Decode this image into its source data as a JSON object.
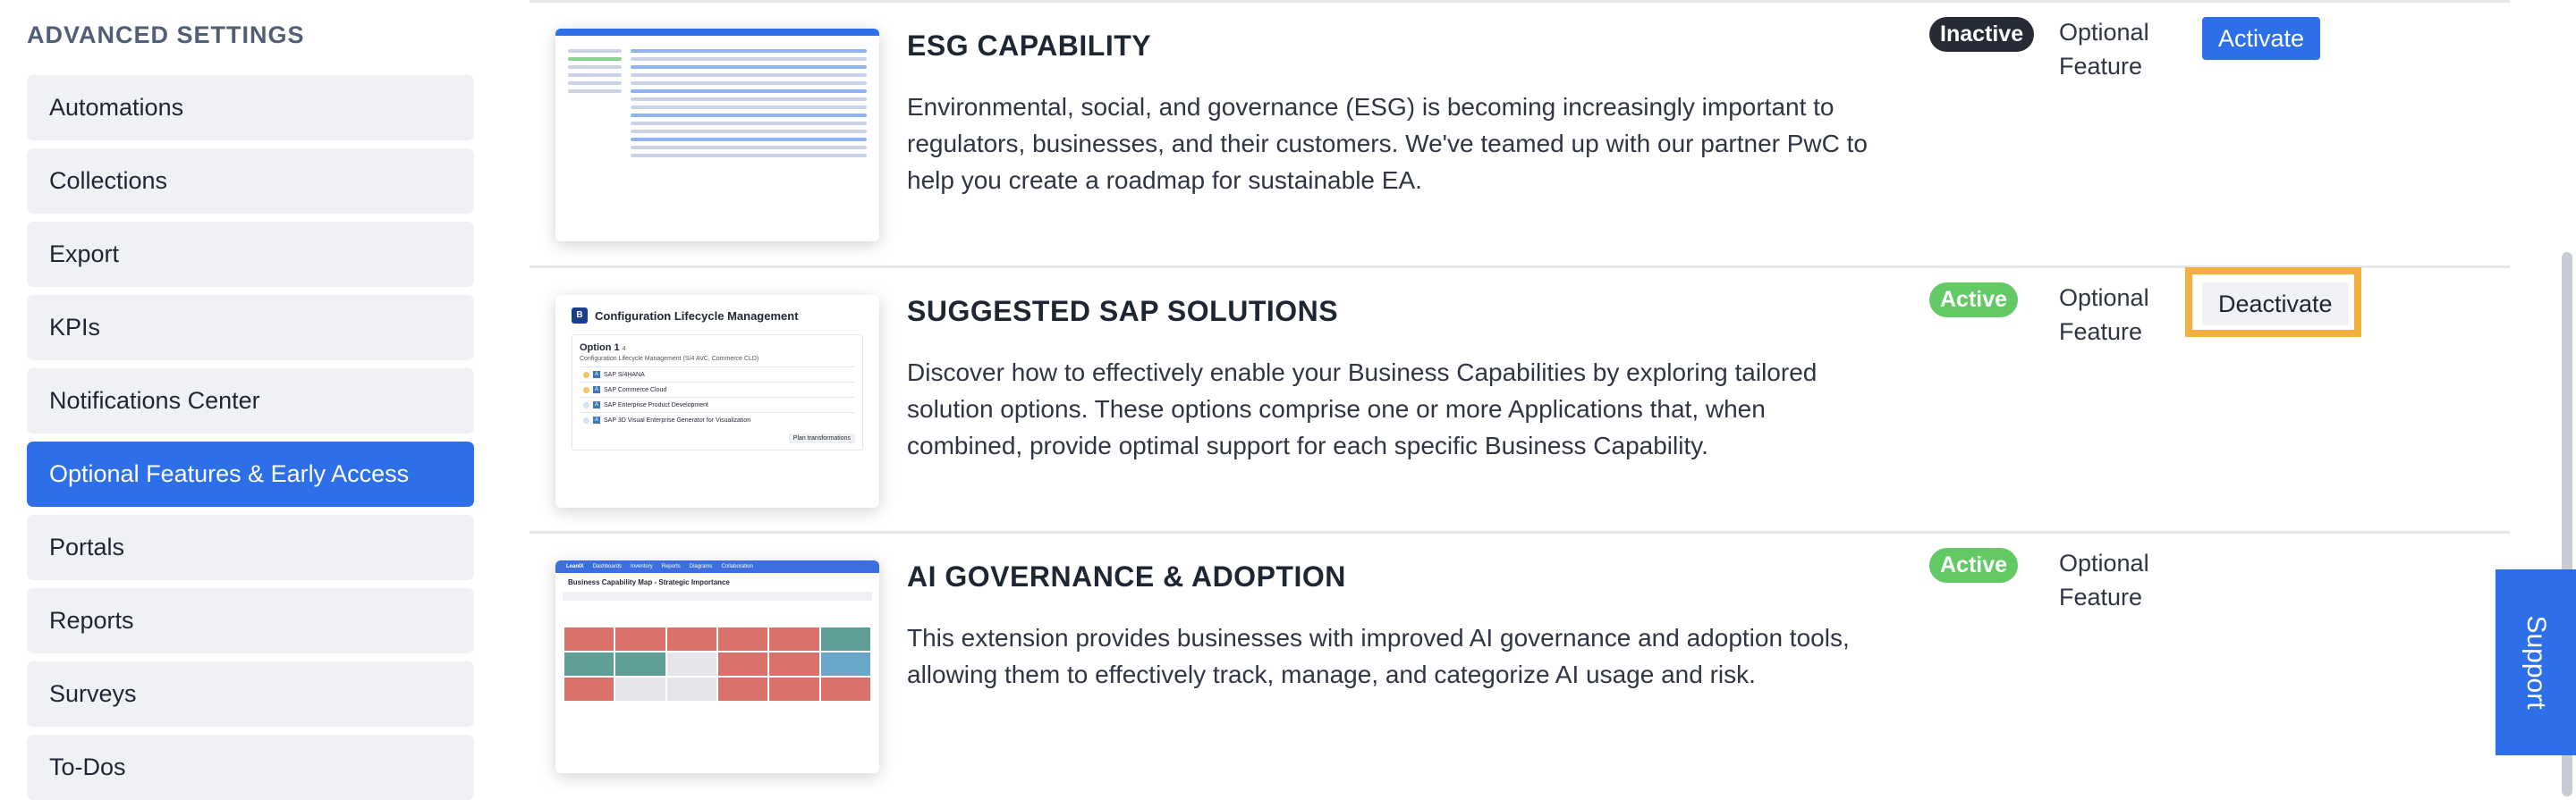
{
  "sidebar": {
    "heading": "ADVANCED SETTINGS",
    "items": [
      {
        "label": "Automations"
      },
      {
        "label": "Collections"
      },
      {
        "label": "Export"
      },
      {
        "label": "KPIs"
      },
      {
        "label": "Notifications Center"
      },
      {
        "label": "Optional Features & Early Access",
        "active": true
      },
      {
        "label": "Portals"
      },
      {
        "label": "Reports"
      },
      {
        "label": "Surveys"
      },
      {
        "label": "To-Dos"
      }
    ]
  },
  "features": [
    {
      "title": "ESG CAPABILITY",
      "description": "Environmental, social, and governance (ESG) is becoming increasingly important to regulators, businesses, and their customers. We've teamed up with our partner PwC to help you create a roadmap for sustainable EA.",
      "status": "Inactive",
      "status_color": "#262b36",
      "type": "Optional Feature",
      "action": "Activate"
    },
    {
      "title": "SUGGESTED SAP SOLUTIONS",
      "description": "Discover how to effectively enable your Business Capabilities by exploring tailored solution options. These options comprise one or more Applications that, when combined, provide optimal support for each specific Business Capability.",
      "status": "Active",
      "status_color": "#63c965",
      "type": "Optional Feature",
      "action": "Deactivate",
      "highlighted": true,
      "thumbnail": {
        "badge": "B",
        "title": "Configuration Lifecycle Management",
        "option": "Option 1",
        "option_count": "4",
        "subtitle": "Configuration Lifecycle Management (S/4 AVC, Commerce CLD)",
        "app_badge": "A",
        "apps": [
          "SAP S/4HANA",
          "SAP Commerce Cloud",
          "SAP Enterprise Product Development",
          "SAP 3D Visual Enterprise Generator for Visualization"
        ],
        "button": "Plan transformations"
      }
    },
    {
      "title": "AI GOVERNANCE & ADOPTION",
      "description": "This extension provides businesses with improved AI governance and adoption tools, allowing them to effectively track, manage, and categorize AI usage and risk.",
      "status": "Active",
      "status_color": "#63c965",
      "type": "Optional Feature",
      "thumbnail": {
        "brand": "LeanIX",
        "nav": [
          "Dashboards",
          "Inventory",
          "Reports",
          "Diagrams",
          "Collaboration"
        ],
        "title": "Business Capability Map - Strategic Importance"
      }
    }
  ],
  "colors": {
    "accent": "#2d6fe8",
    "highlight": "#f4ae40"
  },
  "support": {
    "label": "Support"
  }
}
